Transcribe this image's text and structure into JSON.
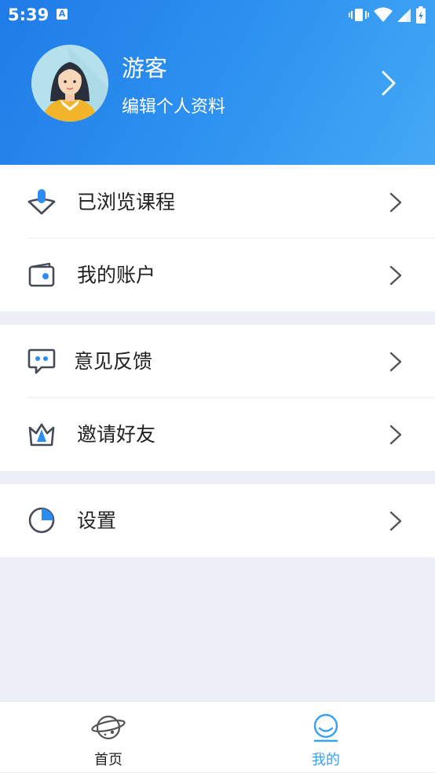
{
  "status_bar": {
    "time": "5:39",
    "notification_glyph": "A"
  },
  "profile": {
    "name": "游客",
    "edit_label": "编辑个人资料"
  },
  "menu_groups": [
    [
      {
        "label": "已浏览课程",
        "icon": "browsed-courses-icon"
      },
      {
        "label": "我的账户",
        "icon": "wallet-icon"
      }
    ],
    [
      {
        "label": "意见反馈",
        "icon": "feedback-chat-icon"
      },
      {
        "label": "邀请好友",
        "icon": "crown-icon"
      }
    ],
    [
      {
        "label": "设置",
        "icon": "settings-pie-icon"
      }
    ]
  ],
  "tabbar": {
    "home_label": "首页",
    "mine_label": "我的",
    "active": "mine"
  },
  "colors": {
    "header_gradient_start": "#1f7be8",
    "header_gradient_end": "#45a9f6",
    "accent": "#2d8cf0",
    "active_tab": "#3aa0f2",
    "page_bg": "#edf0f7"
  }
}
